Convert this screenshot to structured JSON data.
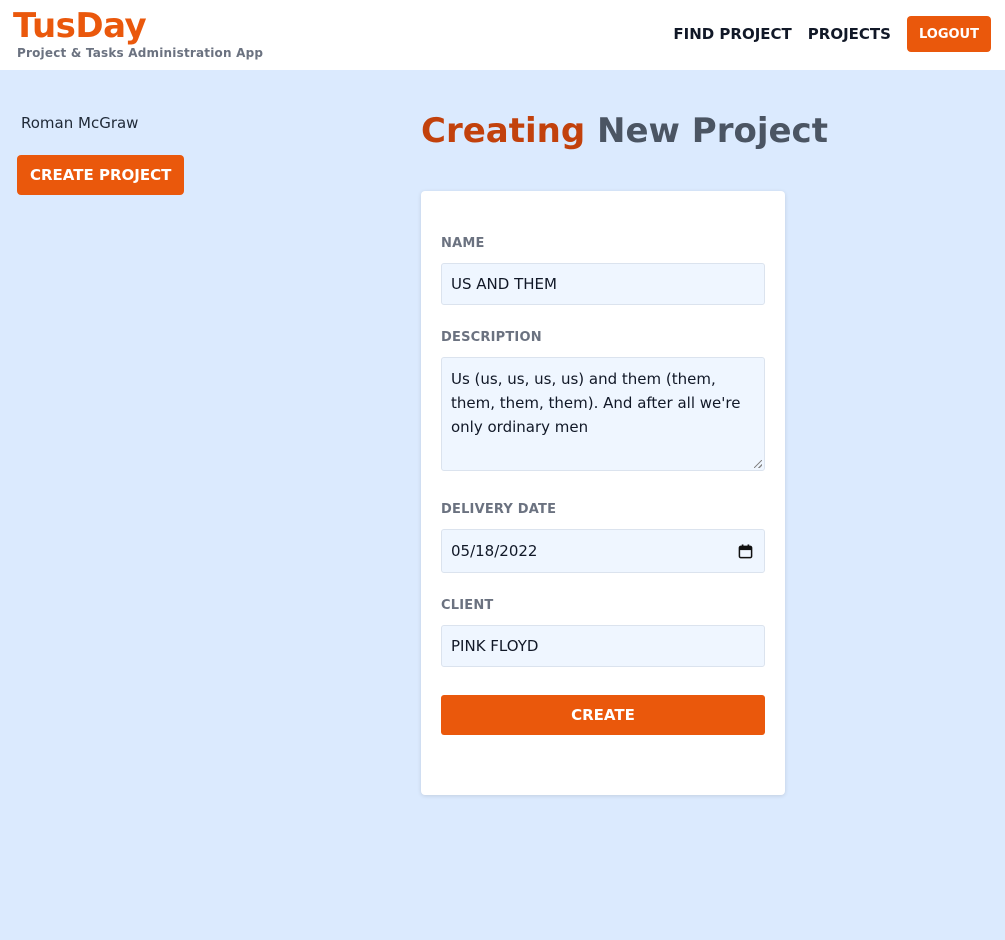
{
  "header": {
    "brand_title": "TusDay",
    "brand_subtitle": "Project & Tasks Administration App",
    "nav": {
      "find_project": "FIND PROJECT",
      "projects": "PROJECTS",
      "logout": "LOGOUT"
    }
  },
  "sidebar": {
    "user_name": "Roman McGraw",
    "create_project_label": "CREATE PROJECT"
  },
  "page": {
    "title_accent": "Creating",
    "title_rest": "New Project"
  },
  "form": {
    "name": {
      "label": "NAME",
      "value": "US AND THEM"
    },
    "description": {
      "label": "DESCRIPTION",
      "value": "Us (us, us, us, us) and them (them, them, them, them). And after all we're only ordinary men"
    },
    "delivery_date": {
      "label": "DELIVERY DATE",
      "value": "05/18/2022"
    },
    "client": {
      "label": "CLIENT",
      "value": "PINK FLOYD"
    },
    "submit_label": "CREATE"
  },
  "icons": {
    "date_picker": "calendar-icon"
  },
  "colors": {
    "accent": "#ea580c",
    "title_accent": "#c2410c",
    "background": "#dbeafe",
    "input_background": "#eff6ff"
  }
}
